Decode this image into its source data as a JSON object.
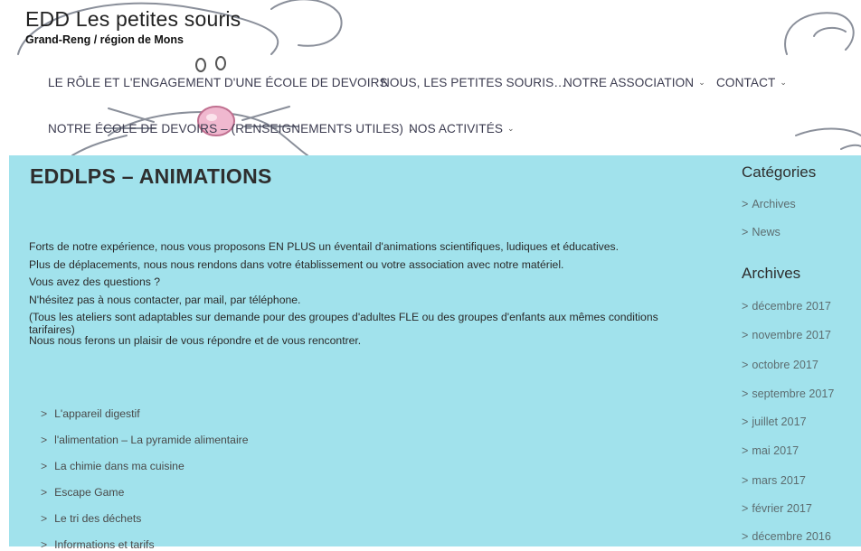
{
  "site": {
    "title": "EDD Les petites souris",
    "tagline": "Grand-Reng / région de Mons"
  },
  "nav": {
    "items": [
      {
        "label": "LE RÔLE ET L'ENGAGEMENT D'UNE ÉCOLE DE DEVOIRS",
        "has_submenu": false
      },
      {
        "label": "NOUS, LES PETITES SOURIS…",
        "has_submenu": false
      },
      {
        "label": "NOTRE ASSOCIATION",
        "has_submenu": true
      },
      {
        "label": "CONTACT",
        "has_submenu": true
      },
      {
        "label": "NOTRE ÉCOLE DE DEVOIRS – (RENSEIGNEMENTS UTILES)",
        "has_submenu": true
      },
      {
        "label": "NOS ACTIVITÉS",
        "has_submenu": true
      }
    ],
    "chevron": "⌄"
  },
  "main": {
    "title": "EDDLPS – ANIMATIONS",
    "paragraphs": [
      "Forts de notre expérience, nous vous proposons EN PLUS un éventail d'animations scientifiques, ludiques et éducatives.",
      "Plus de déplacements, nous nous rendons dans votre établissement ou votre association avec notre matériel.",
      "Vous avez des questions ?",
      "N'hésitez pas à nous contacter, par mail, par téléphone.",
      "(Tous les ateliers sont adaptables sur demande pour des groupes d'adultes FLE ou des groupes d'enfants aux mêmes conditions tarifaires)",
      "Nous nous ferons un plaisir de vous répondre et de vous rencontrer."
    ],
    "links": [
      "L'appareil digestif",
      "l'alimentation – La pyramide alimentaire",
      "La chimie dans ma cuisine",
      "Escape Game",
      "Le tri des déchets",
      "Informations et tarifs"
    ]
  },
  "sidebar": {
    "categories_title": "Catégories",
    "categories": [
      "Archives",
      "News"
    ],
    "archives_title": "Archives",
    "archives": [
      "décembre 2017",
      "novembre 2017",
      "octobre 2017",
      "septembre 2017",
      "juillet 2017",
      "mai 2017",
      "mars 2017",
      "février 2017",
      "décembre 2016"
    ]
  },
  "colors": {
    "content_bg": "#a1e2ec",
    "nav_text": "#3c3c50",
    "sidebar_link": "#5d6d70"
  }
}
